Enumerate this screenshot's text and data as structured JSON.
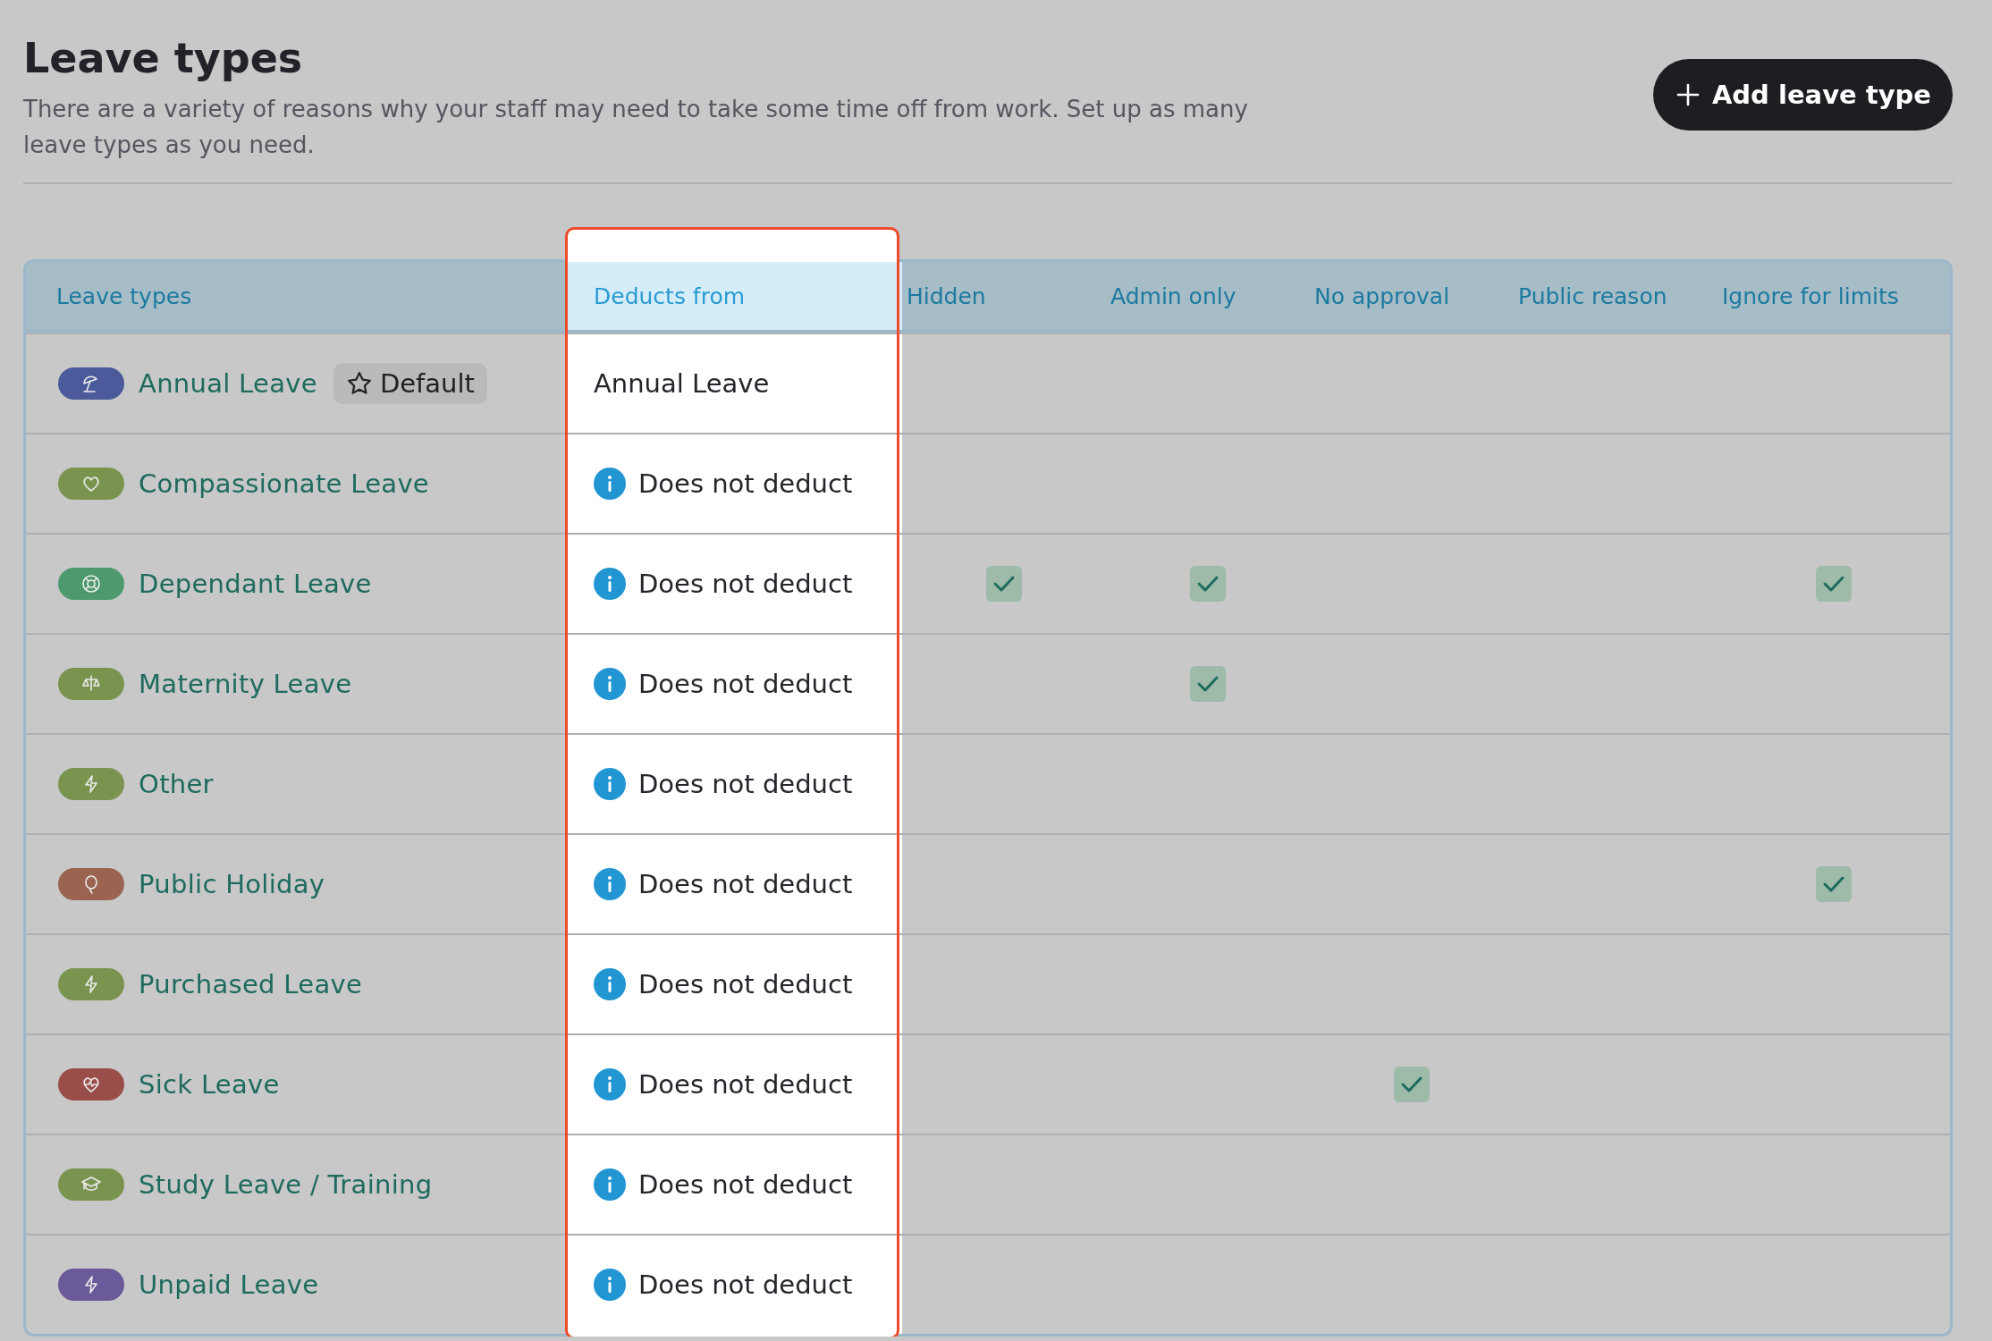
{
  "page": {
    "title": "Leave types",
    "description": "There are a variety of reasons why your staff may need to take some time off from work. Set up as many leave types as you need.",
    "add_button": "Add leave type"
  },
  "table": {
    "columns": [
      {
        "label": "Leave types",
        "highlighted": false
      },
      {
        "label": "Deducts from",
        "highlighted": true
      },
      {
        "label": "Hidden",
        "highlighted": false
      },
      {
        "label": "Admin only",
        "highlighted": false
      },
      {
        "label": "No approval",
        "highlighted": false
      },
      {
        "label": "Public reason",
        "highlighted": false
      },
      {
        "label": "Ignore for limits",
        "highlighted": false
      }
    ],
    "rows": [
      {
        "name": "Annual Leave",
        "color": "#4a5a9a",
        "badge": "Default",
        "deducts_from": {
          "kind": "plain",
          "text": "Annual Leave"
        },
        "hidden": false,
        "admin_only": false,
        "no_approval": false,
        "public_reason": false,
        "ignore_for_limits": false
      },
      {
        "name": "Compassionate Leave",
        "color": "#7a9450",
        "deducts_from": {
          "kind": "info",
          "text": "Does not deduct"
        },
        "hidden": false,
        "admin_only": false,
        "no_approval": false,
        "public_reason": false,
        "ignore_for_limits": false
      },
      {
        "name": "Dependant Leave",
        "color": "#4e9a6e",
        "deducts_from": {
          "kind": "info",
          "text": "Does not deduct"
        },
        "hidden": true,
        "admin_only": true,
        "no_approval": false,
        "public_reason": false,
        "ignore_for_limits": true
      },
      {
        "name": "Maternity Leave",
        "color": "#7a9450",
        "deducts_from": {
          "kind": "info",
          "text": "Does not deduct"
        },
        "hidden": false,
        "admin_only": true,
        "no_approval": false,
        "public_reason": false,
        "ignore_for_limits": false
      },
      {
        "name": "Other",
        "color": "#7a9450",
        "deducts_from": {
          "kind": "info",
          "text": "Does not deduct"
        },
        "hidden": false,
        "admin_only": false,
        "no_approval": false,
        "public_reason": false,
        "ignore_for_limits": false
      },
      {
        "name": "Public Holiday",
        "color": "#9a6450",
        "deducts_from": {
          "kind": "info",
          "text": "Does not deduct"
        },
        "hidden": false,
        "admin_only": false,
        "no_approval": false,
        "public_reason": false,
        "ignore_for_limits": true
      },
      {
        "name": "Purchased Leave",
        "color": "#7a9450",
        "deducts_from": {
          "kind": "info",
          "text": "Does not deduct"
        },
        "hidden": false,
        "admin_only": false,
        "no_approval": false,
        "public_reason": false,
        "ignore_for_limits": false
      },
      {
        "name": "Sick Leave",
        "color": "#9a4e4a",
        "deducts_from": {
          "kind": "info",
          "text": "Does not deduct"
        },
        "hidden": false,
        "admin_only": false,
        "no_approval": true,
        "public_reason": false,
        "ignore_for_limits": false
      },
      {
        "name": "Study Leave / Training",
        "color": "#7a9450",
        "deducts_from": {
          "kind": "info",
          "text": "Does not deduct"
        },
        "hidden": false,
        "admin_only": false,
        "no_approval": false,
        "public_reason": false,
        "ignore_for_limits": false
      },
      {
        "name": "Unpaid Leave",
        "color": "#6a5a9a",
        "deducts_from": {
          "kind": "info",
          "text": "Does not deduct"
        },
        "hidden": false,
        "admin_only": false,
        "no_approval": false,
        "public_reason": false,
        "ignore_for_limits": false
      }
    ]
  }
}
